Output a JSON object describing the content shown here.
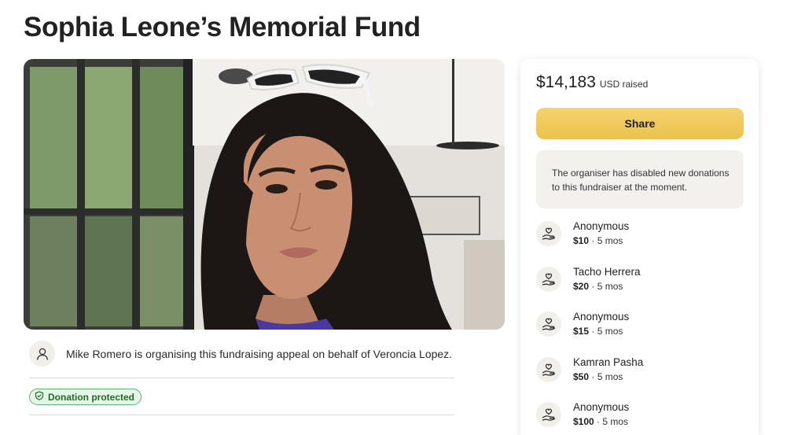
{
  "page": {
    "title": "Sophia Leone’s Memorial Fund"
  },
  "hero": {
    "sunglasses_color": "#f4f4f4",
    "hair_color": "#1c1614",
    "skin_color": "#c98f73"
  },
  "organiser": {
    "text": "Mike Romero is organising this fundraising appeal on behalf of Veroncia Lopez.",
    "icon": "person-icon"
  },
  "badge": {
    "label": "Donation protected",
    "icon": "shield-icon",
    "color": "#5fb36b"
  },
  "card": {
    "amount": "$14,183",
    "amount_suffix": "USD raised",
    "share_label": "Share",
    "share_color": "#ebc24d",
    "notice": "The organiser has disabled new donations to this fundraiser at the moment."
  },
  "donations": [
    {
      "name": "Anonymous",
      "amount": "$10",
      "time": "5 mos",
      "icon": "donation-hand-icon"
    },
    {
      "name": "Tacho Herrera",
      "amount": "$20",
      "time": "5 mos",
      "icon": "donation-hand-icon"
    },
    {
      "name": "Anonymous",
      "amount": "$15",
      "time": "5 mos",
      "icon": "donation-hand-icon"
    },
    {
      "name": "Kamran Pasha",
      "amount": "$50",
      "time": "5 mos",
      "icon": "donation-hand-icon"
    },
    {
      "name": "Anonymous",
      "amount": "$100",
      "time": "5 mos",
      "icon": "donation-hand-icon"
    }
  ]
}
